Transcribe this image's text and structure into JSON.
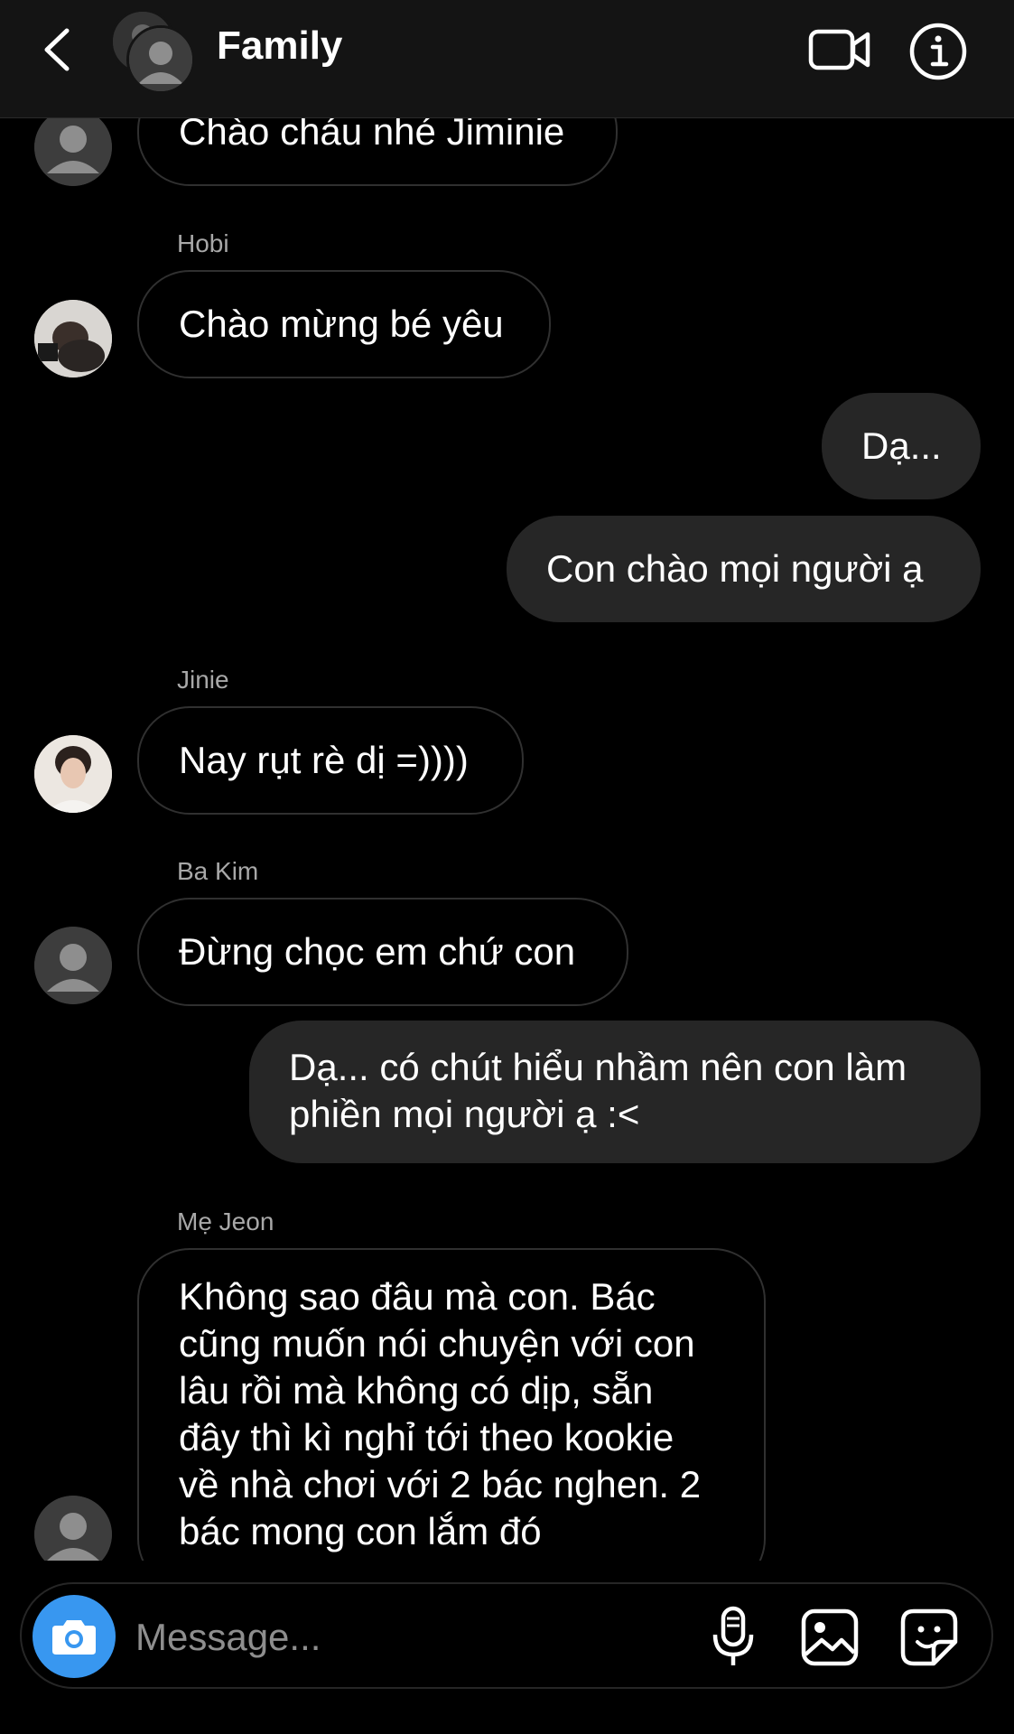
{
  "header": {
    "title": "Family",
    "back_icon": "chevron-left-icon",
    "video_icon": "video-camera-icon",
    "info_icon": "info-icon"
  },
  "messages": [
    {
      "type": "in",
      "sender": "",
      "text": "Chào cháu nhé Jiminie",
      "avatar": "default"
    },
    {
      "type": "in",
      "sender": "Hobi",
      "text": "Chào mừng bé yêu",
      "avatar": "photo"
    },
    {
      "type": "out",
      "text": "Dạ..."
    },
    {
      "type": "out",
      "text": "Con chào mọi người ạ"
    },
    {
      "type": "in",
      "sender": "Jinie",
      "text": "Nay rụt rè dị =))))",
      "avatar": "photo"
    },
    {
      "type": "in",
      "sender": "Ba Kim",
      "text": "Đừng chọc em chứ con",
      "avatar": "default"
    },
    {
      "type": "out",
      "lines": [
        "Dạ... có chút hiểu nhầm nên con làm",
        "phiền mọi người ạ :<"
      ]
    },
    {
      "type": "in",
      "sender": "Mẹ Jeon",
      "avatar": "default",
      "lines": [
        "Không sao đâu mà con. Bác",
        "cũng muốn nói chuyện với con",
        "lâu rồi mà không có dịp, sẵn",
        "đây thì kì nghỉ tới theo kookie",
        "về nhà chơi với 2 bác nghen. 2",
        "bác mong con lắm đó"
      ]
    }
  ],
  "composer": {
    "placeholder": "Message...",
    "camera_icon": "camera-icon",
    "mic_icon": "microphone-icon",
    "gallery_icon": "image-icon",
    "sticker_icon": "sticker-icon"
  },
  "colors": {
    "background": "#000000",
    "header": "#141414",
    "outgoing_bubble": "#262626",
    "incoming_border": "#303030",
    "accent": "#3897f0",
    "sender_label": "#a8a8a8"
  }
}
